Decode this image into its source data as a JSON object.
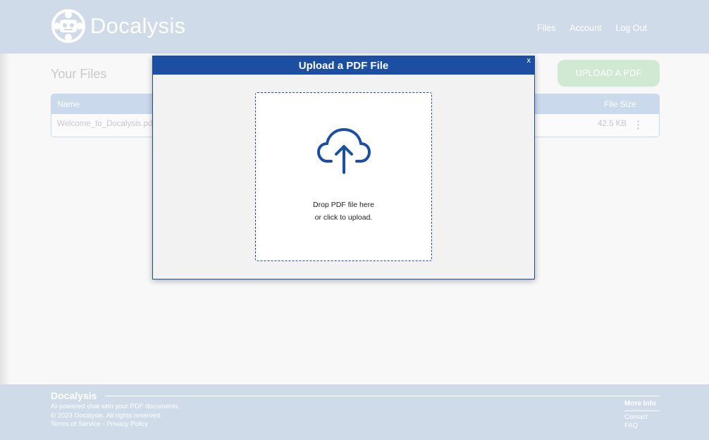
{
  "header": {
    "brand": "Docalysis",
    "nav": {
      "files": "Files",
      "account": "Account",
      "logout": "Log Out"
    }
  },
  "main": {
    "title": "Your Files",
    "upload_button": "UPLOAD A PDF",
    "table": {
      "headers": {
        "name": "Name",
        "size": "File Size"
      },
      "rows": [
        {
          "name": "Welcome_to_Docalysis.pdf",
          "size": "42.5 KB"
        }
      ]
    }
  },
  "modal": {
    "title": "Upload a PDF File",
    "close": "x",
    "drop_line1": "Drop PDF file here",
    "drop_line2": "or click to upload.",
    "icon": "cloud-upload-icon",
    "accent": "#1c4fa2"
  },
  "footer": {
    "brand": "Docalysis",
    "tagline": "AI-powered chat with your PDF documents.",
    "copyright": "© 2023 Docalysis. All rights reserved.",
    "terms": "Terms of Service",
    "separator": " - ",
    "privacy": "Privacy Policy",
    "more_info": "More Info",
    "contact": "Contact",
    "faq": "FAQ"
  },
  "colors": {
    "header_bg": "#d0dbe9",
    "upload_button_bg": "#cfe9d3"
  }
}
